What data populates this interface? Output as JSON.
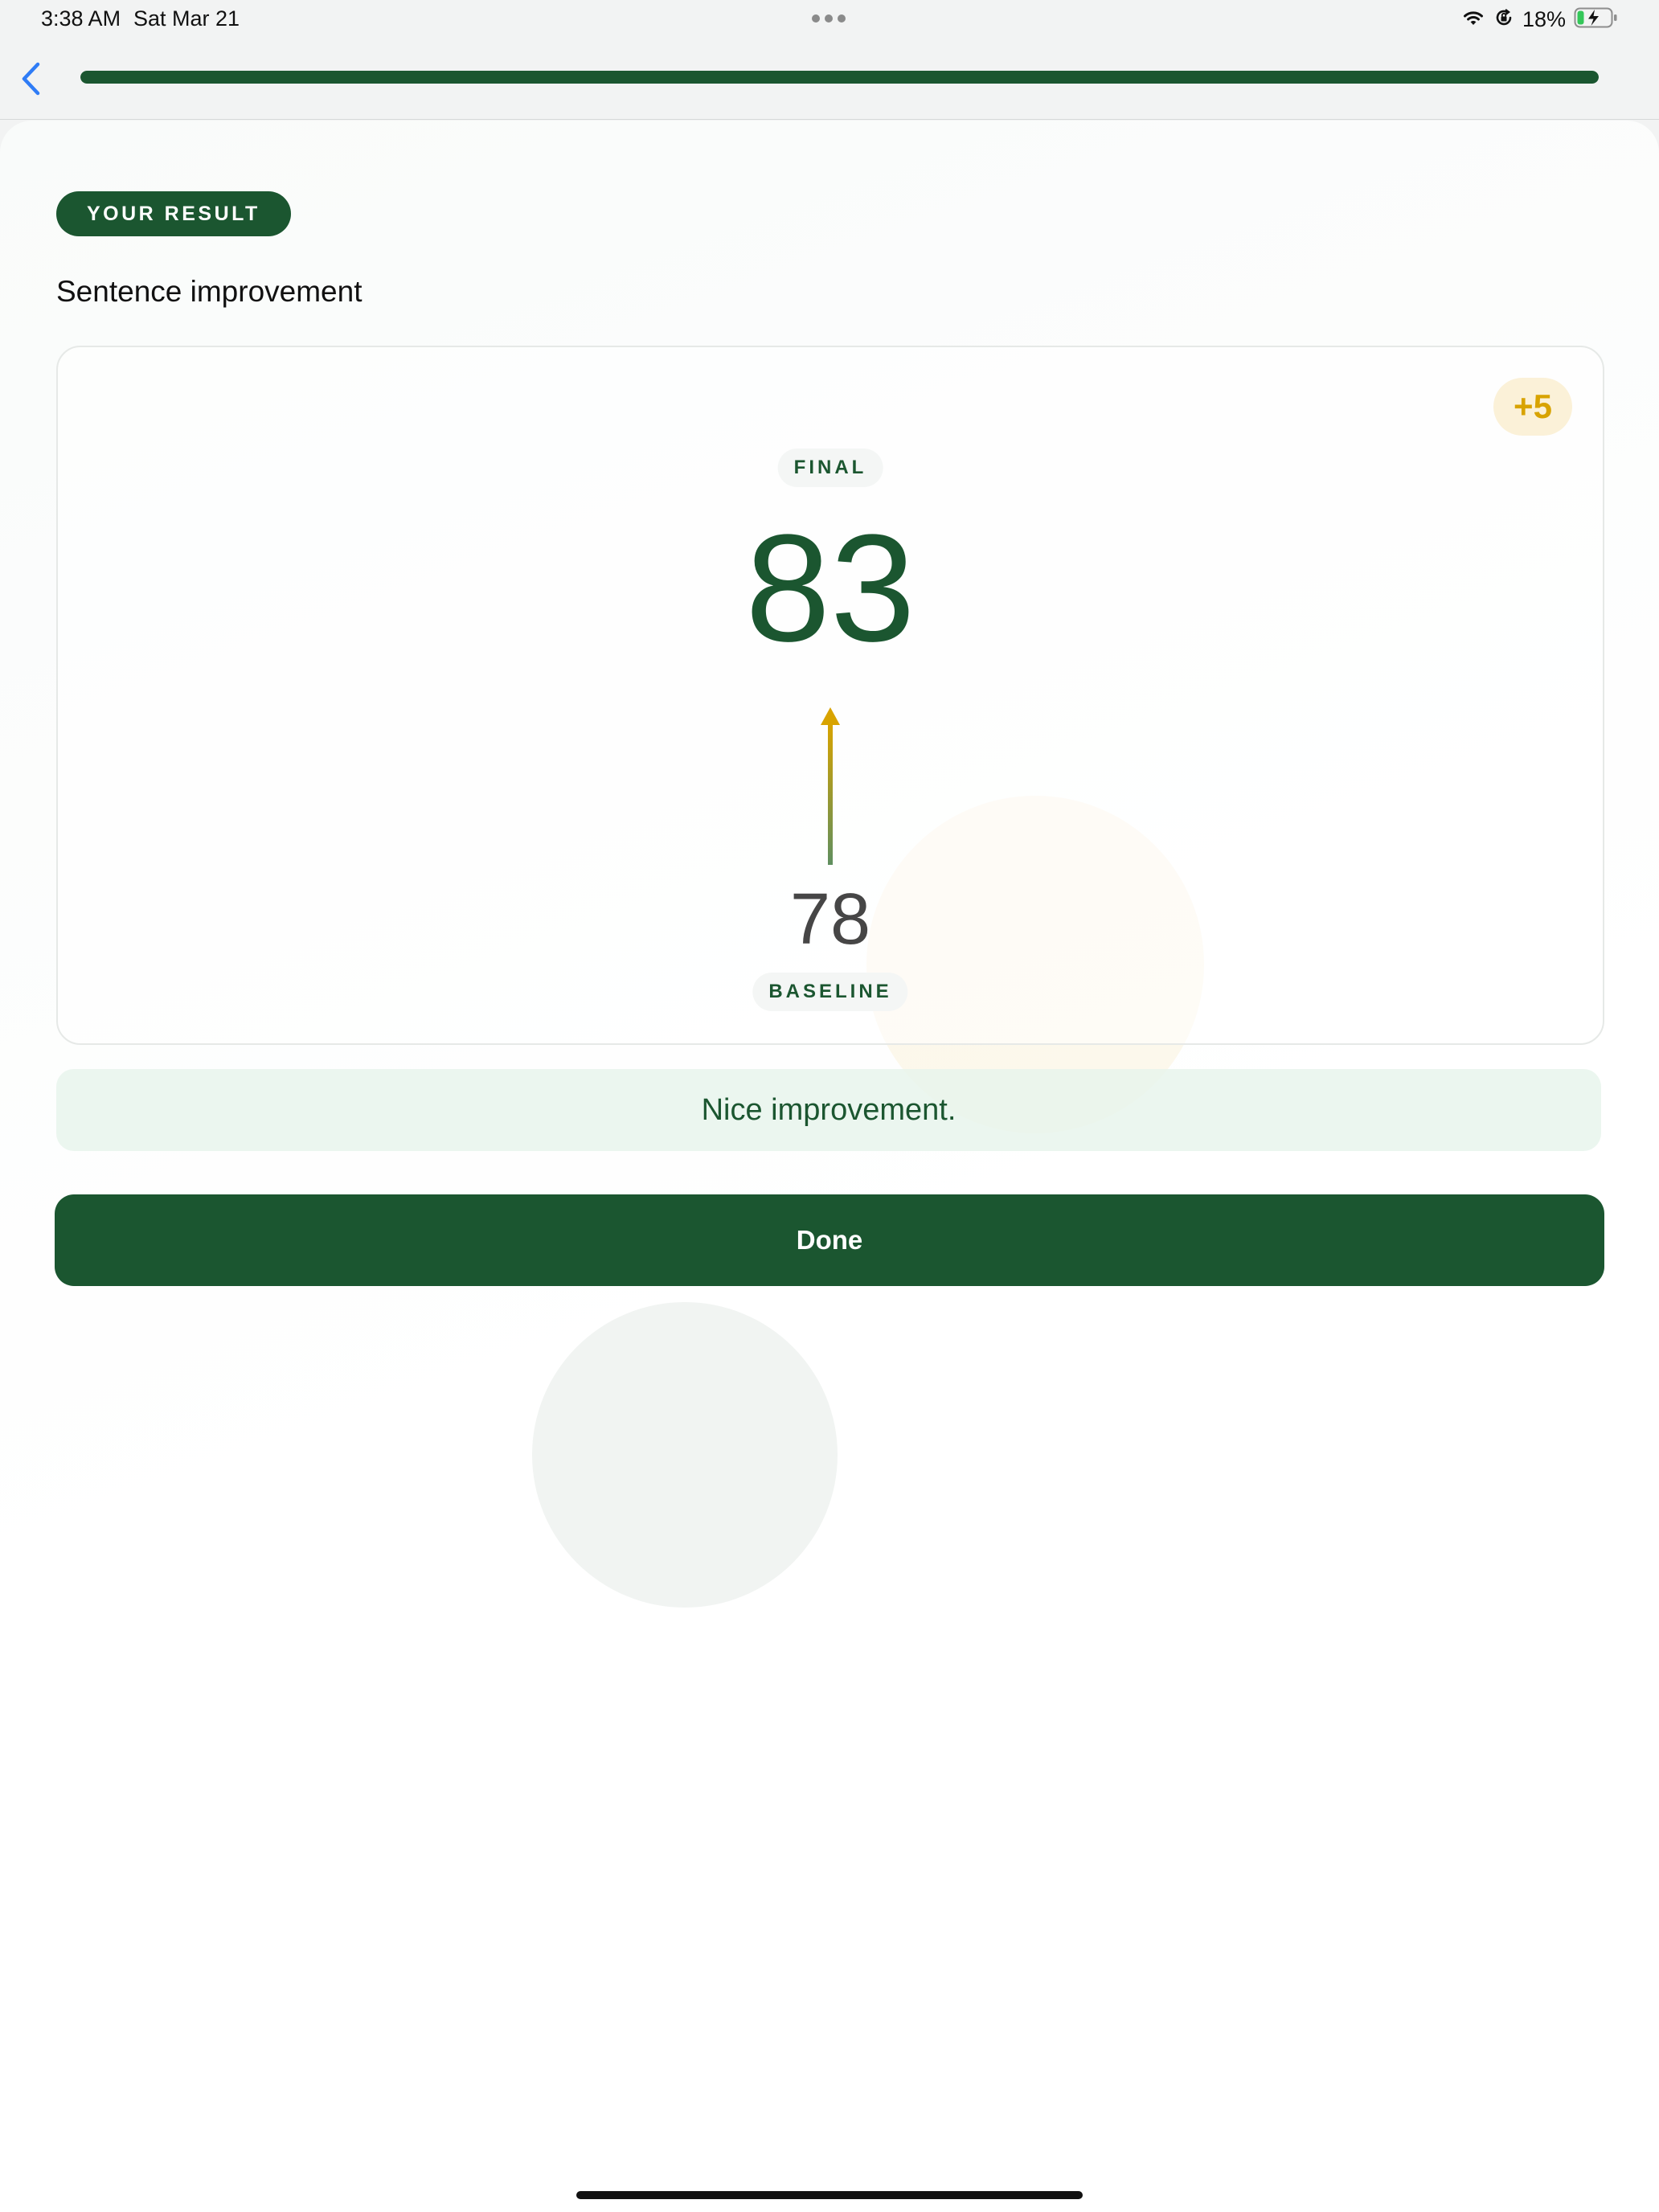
{
  "status_bar": {
    "time": "3:38 AM",
    "date": "Sat Mar 21",
    "battery_percent": "18%",
    "icons": [
      "wifi-icon",
      "orientation-lock-icon",
      "battery-charging-icon"
    ]
  },
  "nav": {
    "back_icon": "chevron-left-icon",
    "progress": 1.0
  },
  "result": {
    "pill_label": "YOUR RESULT",
    "title": "Sentence improvement",
    "delta": "+5",
    "final_label": "FINAL",
    "final_score": "83",
    "baseline_score": "78",
    "baseline_label": "BASELINE",
    "arrow_icon": "arrow-up-icon",
    "message": "Nice improvement."
  },
  "actions": {
    "done_label": "Done"
  },
  "colors": {
    "brand_green": "#1b5630",
    "accent_gold": "#d8a300",
    "ios_blue": "#2f7cf6",
    "message_bg": "#e8f5ec"
  }
}
